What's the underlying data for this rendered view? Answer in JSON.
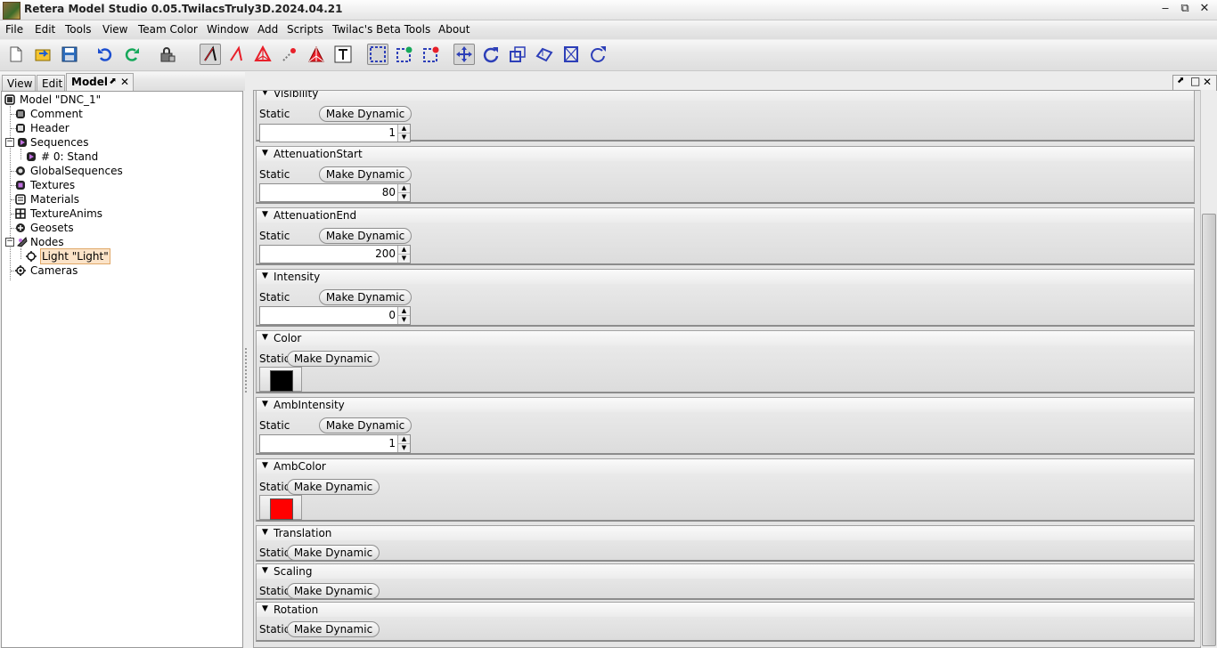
{
  "window": {
    "title": "Retera Model Studio 0.05.TwilacsTruly3D.2024.04.21",
    "minimize": "‒",
    "maximize": "⧉",
    "close": "✕"
  },
  "menu": [
    "File",
    "Edit",
    "Tools",
    "View",
    "Team Color",
    "Window",
    "Add",
    "Scripts",
    "Twilac's Beta Tools",
    "About"
  ],
  "left_tabs": {
    "view": "View",
    "edit": "Edit",
    "model": "Model",
    "pin": "⬈",
    "close": "✕"
  },
  "right_panel_controls": {
    "pin": "⬈",
    "max": "□",
    "close": "✕"
  },
  "tree": {
    "model": "Model \"DNC_1\"",
    "comment": "Comment",
    "header": "Header",
    "sequences": "Sequences",
    "seq0": "# 0: Stand",
    "global_sequences": "GlobalSequences",
    "textures": "Textures",
    "materials": "Materials",
    "texture_anims": "TextureAnims",
    "geosets": "Geosets",
    "nodes": "Nodes",
    "light": "Light \"Light\"",
    "cameras": "Cameras"
  },
  "labels": {
    "static": "Static",
    "make_dynamic": "Make Dynamic",
    "spin_up": "▲",
    "spin_down": "▼",
    "triangle": "▼"
  },
  "sections": {
    "visibility": {
      "title": "Visibility",
      "value": "1"
    },
    "attenuation_start": {
      "title": "AttenuationStart",
      "value": "80"
    },
    "attenuation_end": {
      "title": "AttenuationEnd",
      "value": "200"
    },
    "intensity": {
      "title": "Intensity",
      "value": "0"
    },
    "color": {
      "title": "Color",
      "color": "#000000"
    },
    "amb_intensity": {
      "title": "AmbIntensity",
      "value": "1"
    },
    "amb_color": {
      "title": "AmbColor",
      "color": "#ff0000"
    },
    "translation": {
      "title": "Translation"
    },
    "scaling": {
      "title": "Scaling"
    },
    "rotation": {
      "title": "Rotation"
    }
  },
  "colors": {
    "accent_red": "#e8202a",
    "select_blue": "#2d3fb8",
    "undo_blue": "#1d4fd0",
    "redo_green": "#16a85a"
  }
}
